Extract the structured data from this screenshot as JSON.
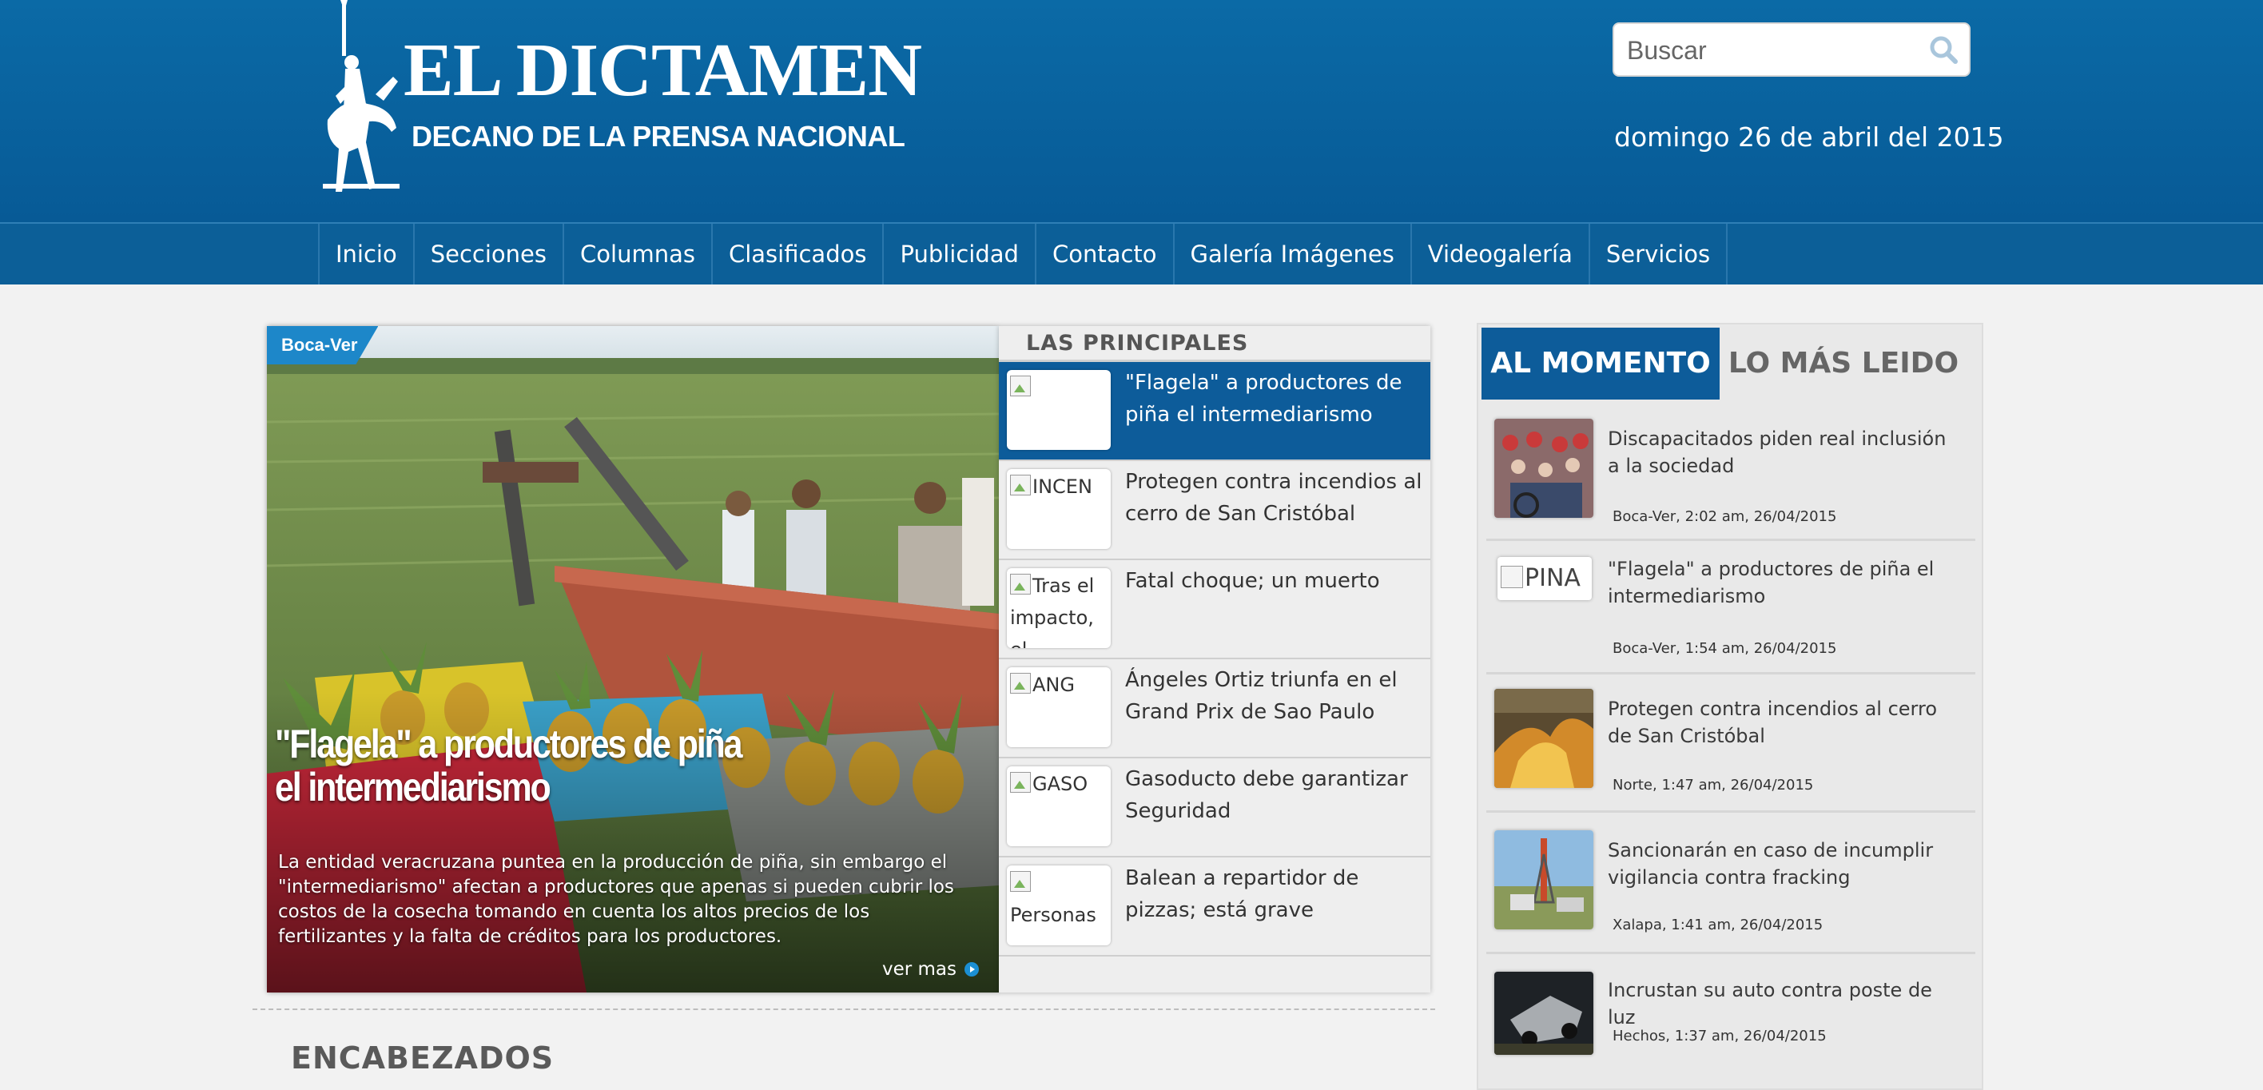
{
  "site": {
    "title": "EL DICTAMEN",
    "subtitle": "DECANO DE LA PRENSA NACIONAL"
  },
  "search": {
    "placeholder": "Buscar"
  },
  "date_text": "domingo 26 de abril del 2015",
  "nav": [
    "Inicio",
    "Secciones",
    "Columnas",
    "Clasificados",
    "Publicidad",
    "Contacto",
    "Galería Imágenes",
    "Videogalería",
    "Servicios"
  ],
  "feature": {
    "badge": "Boca-Ver",
    "title": "\"Flagela\" a productores de piña el intermediarismo",
    "description": "La entidad veracruzana puntea en la producción de piña, sin embargo el \"intermediarismo\" afectan a productores que apenas si pueden cubrir los costos de la cosecha tomando en cuenta los altos precios de los fertilizantes y la falta de créditos para los productores.",
    "more": "ver mas"
  },
  "principales": {
    "heading": "LAS PRINCIPALES",
    "items": [
      {
        "thumb_alt": "",
        "title": "\"Flagela\" a productores de piña el intermediarismo"
      },
      {
        "thumb_alt": "INCEN",
        "title": "Protegen contra incendios al cerro de San Cristóbal"
      },
      {
        "thumb_alt": "Tras el impacto, el",
        "title": "Fatal choque; un muerto"
      },
      {
        "thumb_alt": "ANG",
        "title": "Ángeles Ortiz triunfa en el Grand Prix de Sao Paulo"
      },
      {
        "thumb_alt": "GASO",
        "title": "Gasoducto debe garantizar Seguridad"
      },
      {
        "thumb_alt": "Personas",
        "title": "Balean a repartidor de pizzas; está grave"
      }
    ]
  },
  "encabezados": "ENCABEZADOS",
  "sidebar": {
    "tab_active": "AL MOMENTO",
    "tab_inactive": "LO MÁS LEIDO",
    "items": [
      {
        "title": "Discapacitados piden real inclusión a la sociedad",
        "meta": "Boca-Ver, 2:02 am, 26/04/2015"
      },
      {
        "thumb_alt": "PINA",
        "title": "\"Flagela\" a productores de piña el intermediarismo",
        "meta": "Boca-Ver, 1:54 am, 26/04/2015"
      },
      {
        "title": "Protegen contra incendios al cerro de San Cristóbal",
        "meta": "Norte, 1:47 am, 26/04/2015"
      },
      {
        "title": "Sancionarán en caso de incumplir vigilancia contra fracking",
        "meta": "Xalapa, 1:41 am, 26/04/2015"
      },
      {
        "title": "Incrustan su auto contra poste de luz",
        "meta": "Hechos, 1:37 am, 26/04/2015"
      }
    ]
  },
  "colors": {
    "header_blue": "#0b6aa6",
    "nav_blue": "#0c5f98",
    "active_blue": "#0d5c9a",
    "badge_blue": "#1d87c9"
  }
}
